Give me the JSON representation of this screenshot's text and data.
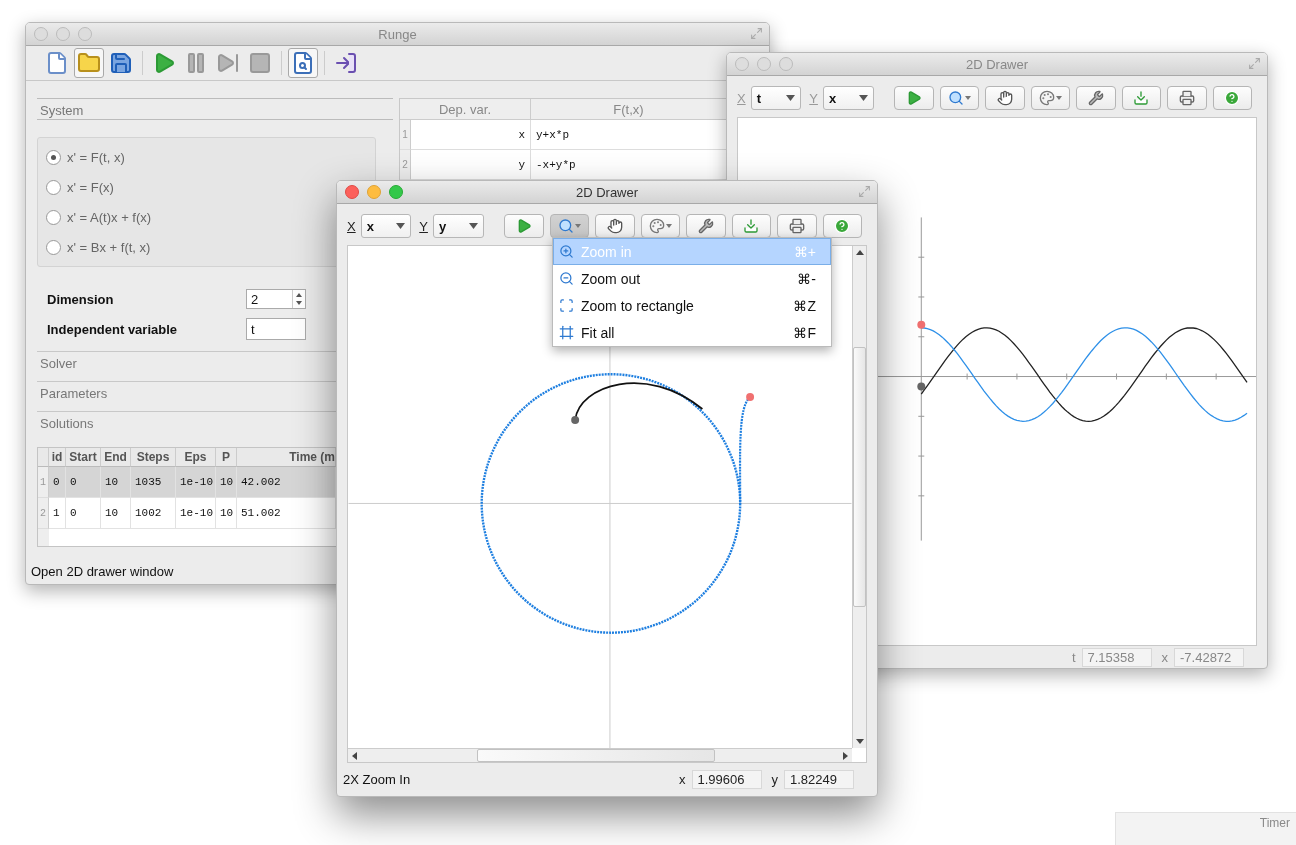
{
  "runge": {
    "title": "Runge",
    "active": false,
    "toolbar": [
      [
        {
          "kind": "new",
          "disabled": false,
          "pressed": false
        },
        {
          "kind": "open",
          "disabled": false,
          "pressed": true
        },
        {
          "kind": "save",
          "disabled": false,
          "pressed": false
        }
      ],
      [
        {
          "kind": "run",
          "disabled": false,
          "pressed": false
        },
        {
          "kind": "pause",
          "disabled": true,
          "pressed": false
        },
        {
          "kind": "step",
          "disabled": true,
          "pressed": false
        },
        {
          "kind": "stop",
          "disabled": true,
          "pressed": false
        }
      ],
      [
        {
          "kind": "preview",
          "disabled": false,
          "pressed": true
        }
      ],
      [
        {
          "kind": "exit",
          "disabled": false,
          "pressed": false
        }
      ]
    ],
    "system_tab": "System",
    "equation_forms": [
      {
        "label": "x' = F(t, x)",
        "selected": true
      },
      {
        "label": "x' = F(x)",
        "selected": false
      },
      {
        "label": "x' = A(t)x + f(x)",
        "selected": false
      },
      {
        "label": "x' = Bx + f(t, x)",
        "selected": false
      }
    ],
    "dimension": {
      "label": "Dimension",
      "value": "2"
    },
    "independent_variable": {
      "label": "Independent variable",
      "value": "t"
    },
    "sections": [
      "Solver",
      "Parameters",
      "Solutions"
    ],
    "solutions": {
      "columns": [
        "id",
        "Start",
        "End",
        "Steps",
        "Eps",
        "P",
        "Time (m"
      ],
      "rows": [
        {
          "index": "1",
          "cells": [
            "0",
            "0",
            "10",
            "1035",
            "1e-10",
            "10",
            "42.002"
          ],
          "selected": true
        },
        {
          "index": "2",
          "cells": [
            "1",
            "0",
            "10",
            "1002",
            "1e-10",
            "10",
            "51.002"
          ],
          "selected": false
        }
      ]
    },
    "status": "Open 2D drawer window",
    "variables": {
      "columns": [
        "Dep. var.",
        "F(t,x)"
      ],
      "rows": [
        {
          "index": "1",
          "variable": "x",
          "function": "y+x*p"
        },
        {
          "index": "2",
          "variable": "y",
          "function": "-x+y*p"
        }
      ]
    }
  },
  "drawers": [
    {
      "title": "2D Drawer",
      "active": false,
      "x_label": "X",
      "x_value": "t",
      "y_label": "Y",
      "y_value": "x",
      "toolbar": [
        {
          "kind": "run",
          "pressed": false
        },
        {
          "kind": "zoom",
          "pressed": false
        },
        {
          "kind": "pan",
          "pressed": false
        },
        {
          "kind": "colors",
          "pressed": false
        },
        {
          "kind": "settings",
          "pressed": false
        },
        {
          "kind": "export",
          "pressed": false
        },
        {
          "kind": "print",
          "pressed": false
        },
        {
          "kind": "help",
          "pressed": false
        }
      ],
      "plot": {
        "kind": "time_series"
      },
      "readouts": [
        {
          "label": "t",
          "value": "7.15358"
        },
        {
          "label": "x",
          "value": "-7.42872"
        }
      ]
    },
    {
      "title": "2D Drawer",
      "active": true,
      "x_label": "X",
      "x_value": "x",
      "y_label": "Y",
      "y_value": "y",
      "toolbar": [
        {
          "kind": "run",
          "pressed": false
        },
        {
          "kind": "zoom",
          "pressed": true
        },
        {
          "kind": "pan",
          "pressed": false
        },
        {
          "kind": "colors",
          "pressed": false
        },
        {
          "kind": "settings",
          "pressed": false
        },
        {
          "kind": "export",
          "pressed": false
        },
        {
          "kind": "print",
          "pressed": false
        },
        {
          "kind": "help",
          "pressed": false
        }
      ],
      "zoom_menu": [
        {
          "kind": "zoom_in",
          "label": "Zoom in",
          "shortcut": "⌘+",
          "selected": true
        },
        {
          "kind": "zoom_out",
          "label": "Zoom out",
          "shortcut": "⌘-",
          "selected": false
        },
        {
          "kind": "zoom_rect",
          "label": "Zoom to rectangle",
          "shortcut": "⌘Z",
          "selected": false
        },
        {
          "kind": "fit",
          "label": "Fit all",
          "shortcut": "⌘F",
          "selected": false
        }
      ],
      "plot": {
        "kind": "phase"
      },
      "status": "2X Zoom In",
      "readouts": [
        {
          "label": "x",
          "value": "1.99606"
        },
        {
          "label": "y",
          "value": "1.82249"
        }
      ]
    }
  ],
  "timer": {
    "title": "Timer"
  }
}
